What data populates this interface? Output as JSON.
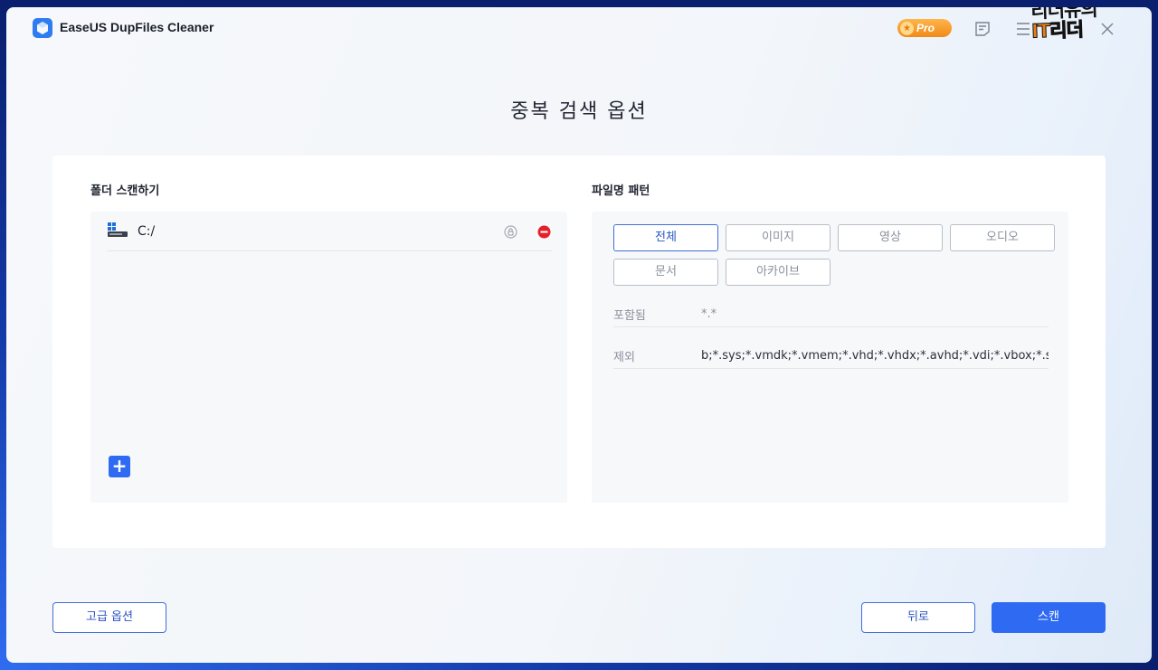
{
  "app": {
    "title": "EaseUS DupFiles Cleaner",
    "pro_label": "Pro",
    "watermark_line1": "리더유의",
    "watermark_line2": "IT리더"
  },
  "icons": {
    "logo": "easeus-cube-icon",
    "feedback": "feedback-icon",
    "menu": "menu-icon",
    "close": "close-icon",
    "drive": "windows-drive-icon",
    "lock": "lock-icon",
    "remove": "remove-icon",
    "add": "plus-icon"
  },
  "page": {
    "title": "중복 검색 옵션"
  },
  "scan_folders": {
    "label": "폴더 스캔하기",
    "items": [
      {
        "path": "C:/"
      }
    ],
    "add_label": "+"
  },
  "file_pattern": {
    "label": "파일명 패턴",
    "chips": [
      "전체",
      "이미지",
      "영상",
      "오디오",
      "문서",
      "아카이브"
    ],
    "selected_chip": "전체",
    "include_label": "포함됨",
    "include_value": "*.*",
    "exclude_label": "제외",
    "exclude_value": "b;*.sys;*.vmdk;*.vmem;*.vhd;*.vhdx;*.avhd;*.vdi;*.vbox;*.sav;"
  },
  "footer": {
    "advanced_label": "고급 옵션",
    "back_label": "뒤로",
    "scan_label": "스캔"
  },
  "colors": {
    "accent": "#2f6bf2",
    "pro_badge": "#f08a18",
    "remove": "#e5202a"
  }
}
